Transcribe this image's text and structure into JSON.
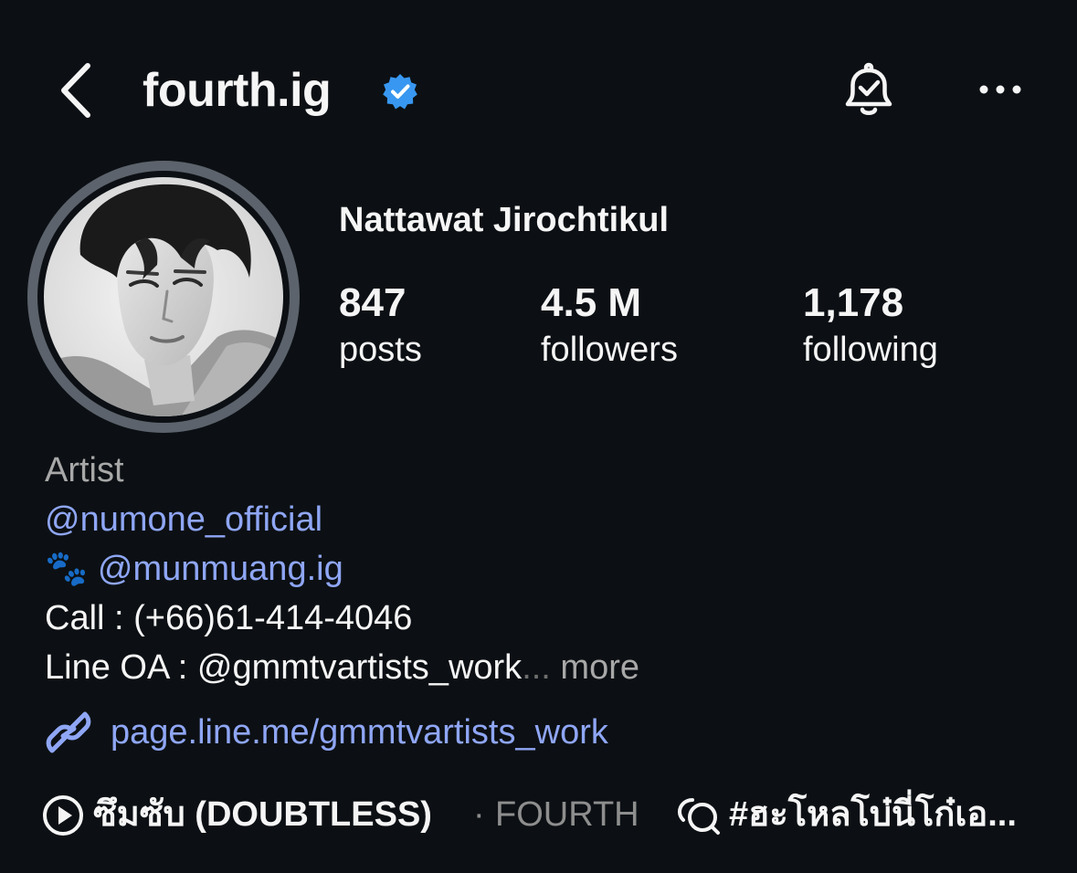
{
  "header": {
    "username": "fourth.ig",
    "icons": [
      "back-chevron-icon",
      "verified-badge-icon",
      "notification-bell-icon",
      "more-options-icon"
    ],
    "accent_color": "#3897f0"
  },
  "profile": {
    "full_name": "Nattawat Jirochtikul",
    "stats": [
      {
        "value": "847",
        "label": "posts"
      },
      {
        "value": "4.5 M",
        "label": "followers"
      },
      {
        "value": "1,178",
        "label": "following"
      }
    ]
  },
  "bio": {
    "category": "Artist",
    "mention1": "@numone_official",
    "paw_emoji": "🐾",
    "mention2": "@munmuang.ig",
    "call": "Call : (+66)61-414-4046",
    "line_prefix": "Line OA : ",
    "line_handle": "@gmmtvartists_work",
    "ellipsis": "...",
    "more": " more",
    "link": "page.line.me/gmmtvartists_work"
  },
  "music": {
    "title": "ซึมซับ (DOUBTLESS)",
    "separator": "·",
    "artist": "FOURTH"
  },
  "thread": {
    "text": "#ฮะโหลโบ๋นี่โก๋เอ..."
  },
  "colors": {
    "background": "#0c1014",
    "link": "#8fa6f5",
    "secondary_text": "#a8a8a8"
  }
}
